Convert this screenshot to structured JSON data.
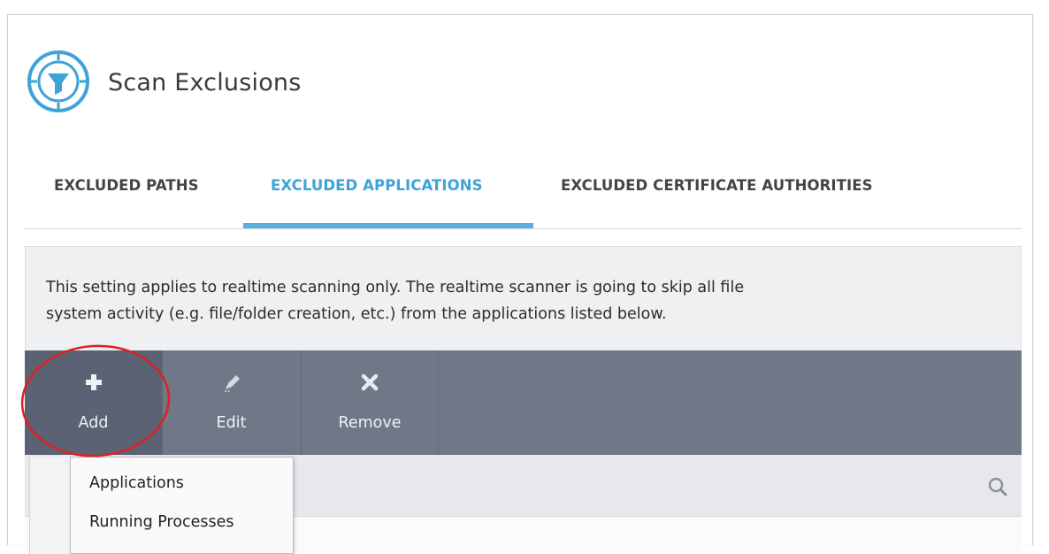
{
  "page": {
    "title": "Scan Exclusions",
    "title_icon": "scan-exclusions-filter-icon",
    "accent_color": "#3fa3d9"
  },
  "tabs": [
    {
      "label": "EXCLUDED PATHS",
      "active": false
    },
    {
      "label": "EXCLUDED APPLICATIONS",
      "active": true
    },
    {
      "label": "EXCLUDED CERTIFICATE AUTHORITIES",
      "active": false
    }
  ],
  "description": {
    "line1": "This setting applies to realtime scanning only. The realtime scanner is going to skip all file",
    "line2": "system activity (e.g. file/folder creation, etc.) from the applications listed below."
  },
  "toolbar": {
    "add_label": "Add",
    "add_icon": "plus-icon",
    "edit_label": "Edit",
    "edit_icon": "pencil-icon",
    "remove_label": "Remove",
    "remove_icon": "x-icon",
    "bg_color": "#707888"
  },
  "add_menu": {
    "items": [
      "Applications",
      "Running Processes"
    ]
  },
  "search": {
    "icon": "search-icon"
  },
  "annotation": {
    "color": "#e02020"
  }
}
